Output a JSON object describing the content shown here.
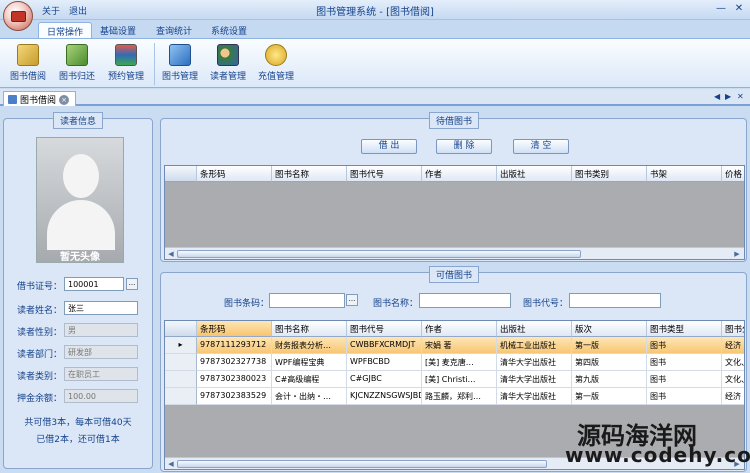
{
  "window": {
    "title": "图书管理系统 - [图书借阅]",
    "quick_about": "关于",
    "quick_exit": "退出",
    "min": "—",
    "close": "✕"
  },
  "ribbon_tabs": [
    "日常操作",
    "基础设置",
    "查询统计",
    "系统设置"
  ],
  "ribbon_buttons": [
    "图书借阅",
    "图书归还",
    "预约管理",
    "图书管理",
    "读者管理",
    "充值管理"
  ],
  "doc_tab": {
    "label": "图书借阅",
    "close": "×",
    "nav_prev": "◀",
    "nav_next": "▶",
    "nav_close": "✕"
  },
  "reader": {
    "group_title": "读者信息",
    "photo_label": "暂无头像",
    "fields": [
      {
        "label": "借书证号：",
        "value": "100001"
      },
      {
        "label": "读者姓名：",
        "value": "张三"
      },
      {
        "label": "读者性别：",
        "value": "男"
      },
      {
        "label": "读者部门：",
        "value": "研发部"
      },
      {
        "label": "读者类别：",
        "value": "在职员工"
      },
      {
        "label": "押金余额：",
        "value": "100.00"
      }
    ],
    "dots": "...",
    "summary_line1": "共可借3本，每本可借40天",
    "summary_line2": "已借2本，还可借1本"
  },
  "pending": {
    "group_title": "待借图书",
    "btn_borrow": "借 出",
    "btn_delete": "删 除",
    "btn_clear": "清 空",
    "columns": [
      "条形码",
      "图书名称",
      "图书代号",
      "作者",
      "出版社",
      "图书类别",
      "书架",
      "价格"
    ]
  },
  "available": {
    "group_title": "可借图书",
    "search_barcode_label": "图书条码：",
    "search_name_label": "图书名称：",
    "search_code_label": "图书代号：",
    "dots": "...",
    "columns": [
      "条形码",
      "图书名称",
      "图书代号",
      "作者",
      "出版社",
      "版次",
      "图书类型",
      "图书分"
    ],
    "rows": [
      {
        "selected": true,
        "cells": [
          "9787111293712",
          "财务报表分析…",
          "CWBBFXCRMDJT",
          "宋娟 著",
          "机械工业出版社",
          "第一版",
          "图书",
          "经济"
        ]
      },
      {
        "selected": false,
        "cells": [
          "9787302327738",
          "WPF编程宝典",
          "WPFBCBD",
          "[美] 麦克唐…",
          "清华大学出版社",
          "第四版",
          "图书",
          "文化、"
        ]
      },
      {
        "selected": false,
        "cells": [
          "9787302380023",
          "C#高级编程",
          "C#GJBC",
          "[美] Christi…",
          "清华大学出版社",
          "第九版",
          "图书",
          "文化、"
        ]
      },
      {
        "selected": false,
        "cells": [
          "9787302383529",
          "会计・出纳・…",
          "KJCNZZNSGWSJBD",
          "路玉麟，郑利…",
          "清华大学出版社",
          "第一版",
          "图书",
          "经济"
        ]
      }
    ]
  },
  "watermark": {
    "line1": "源码海洋网",
    "line2": "www.codehy.com"
  },
  "colors": {
    "selected_row": "#f8c46f",
    "header_text": "#15428b",
    "grid_bg": "#abacaf"
  }
}
